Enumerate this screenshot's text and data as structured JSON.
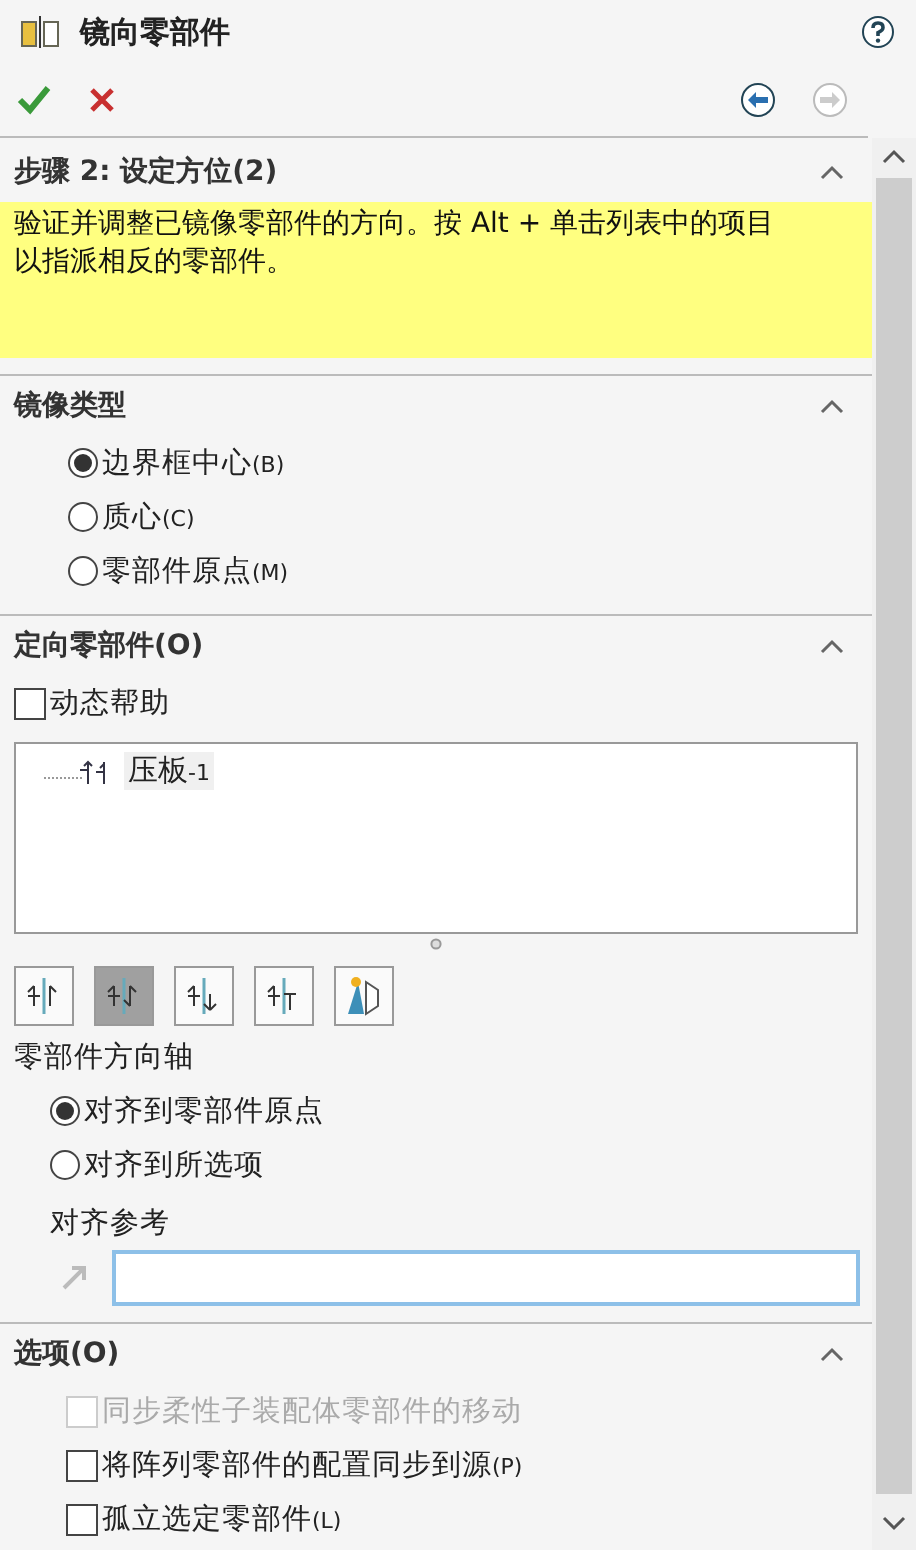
{
  "title": "镜向零部件",
  "nav": {
    "back_enabled": true,
    "forward_enabled": false
  },
  "sections": [
    {
      "kind": "message",
      "title": "步骤 2: 设定方位(2)",
      "expanded": true,
      "text": "验证并调整已镜像零部件的方向。按 Alt + 单击列表中的项目以指派相反的零部件。"
    },
    {
      "kind": "radios",
      "title": "镜像类型",
      "expanded": true,
      "options": [
        {
          "label": "边界框中心",
          "shortcut": "(B)",
          "selected": true
        },
        {
          "label": "质心",
          "shortcut": "(C)",
          "selected": false
        },
        {
          "label": "零部件原点",
          "shortcut": "(M)",
          "selected": false
        }
      ]
    },
    {
      "kind": "orient",
      "title": "定向零部件(O)",
      "expanded": true,
      "dynamic_help": {
        "label": "动态帮助",
        "checked": false
      },
      "components": [
        {
          "label": "压板",
          "suffix": "-1"
        }
      ],
      "orient_buttons": [
        {
          "selected": false
        },
        {
          "selected": true
        },
        {
          "selected": false
        },
        {
          "selected": false
        },
        {
          "selected": false
        }
      ],
      "axis_label": "零部件方向轴",
      "axis_options": [
        {
          "label": "对齐到零部件原点",
          "selected": true
        },
        {
          "label": "对齐到所选项",
          "selected": false
        }
      ],
      "reference_label": "对齐参考"
    },
    {
      "kind": "checks",
      "title": "选项(O)",
      "expanded": true,
      "options": [
        {
          "label": "同步柔性子装配体零部件的移动",
          "checked": false,
          "disabled": true
        },
        {
          "label": "将阵列零部件的配置同步到源",
          "shortcut": "(P)",
          "checked": false,
          "disabled": false
        },
        {
          "label": "孤立选定零部件",
          "shortcut": "(L)",
          "checked": false,
          "disabled": false
        }
      ]
    }
  ]
}
